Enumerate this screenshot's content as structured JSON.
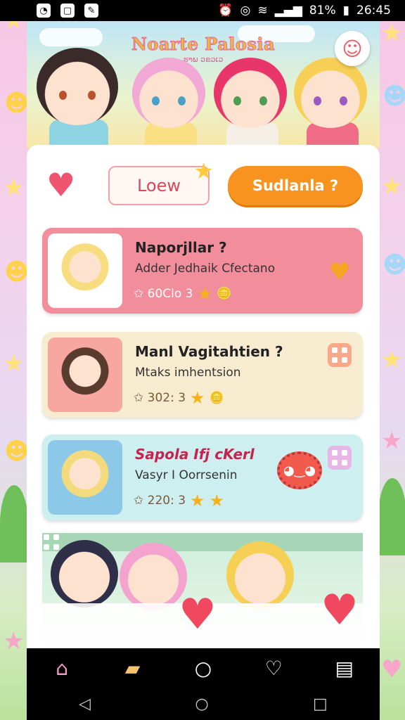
{
  "statusbar": {
    "battery": "81%",
    "time": "26:45",
    "left_icons": [
      "clock-app-icon",
      "square-app-icon",
      "tools-app-icon"
    ]
  },
  "banner": {
    "title": "Noarte Palosia",
    "subtitle": "ຮາພ ວຂວເວ"
  },
  "top_actions": {
    "loew_label": "Loew",
    "pill_label": "Sudlanla ?"
  },
  "cards": [
    {
      "title": "Naporjllar ?",
      "desc": "Adder Jedhaik Cfectano",
      "meta": "✩ 60Clo 3",
      "bg": "#f28d9b",
      "title_color": "#222"
    },
    {
      "title": "Manl Vagitahtien ?",
      "desc": "Mtaks imhentsion",
      "meta": "✩ 302: 3",
      "bg": "#f8ecd0",
      "title_color": "#222"
    },
    {
      "title": "Sapola Ifj cKerl",
      "desc": "Vasyr I Oorrsenin",
      "meta": "✩ 220: 3",
      "bg": "#cdeff0",
      "title_color": "#c2254d"
    }
  ],
  "nav": [
    "home-icon",
    "cards-icon",
    "search-icon",
    "heart-icon",
    "stack-icon"
  ],
  "colors": {
    "accent": "#f7931e",
    "heart": "#ef5370",
    "pink_card": "#f28d9b"
  }
}
